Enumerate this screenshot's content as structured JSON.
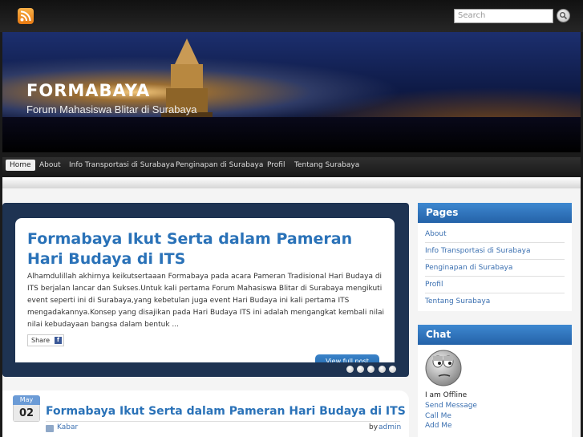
{
  "search": {
    "placeholder": "Search"
  },
  "site": {
    "title": "FORMABAYA",
    "description": "Forum Mahasiswa Blitar di Surabaya"
  },
  "nav": {
    "items": [
      "Home",
      "About",
      "Info Transportasi di Surabaya",
      "Penginapan di Surabaya",
      "Profil",
      "Tentang Surabaya"
    ]
  },
  "featured": {
    "title": "Formabaya Ikut Serta dalam Pameran Hari Budaya di ITS",
    "excerpt": "Alhamdulillah akhirnya keikutsertaaan Formabaya pada acara Pameran Tradisional Hari Budaya di ITS berjalan lancar dan Sukses.Untuk kali pertama Forum Mahasiswa Blitar di Surabaya mengikuti event seperti ini di Surabaya,yang kebetulan juga event Hari Budaya ini kali pertama ITS mengadakannya.Konsep yang disajikan pada Hari Budaya ITS ini adalah mengangkat kembali nilai nilai kebudayaan bangsa dalam bentuk ...",
    "share_label": "Share",
    "view_label": "View full post"
  },
  "post": {
    "month": "May",
    "day": "02",
    "title": "Formabaya Ikut Serta dalam Pameran Hari Budaya di ITS",
    "category": "Kabar",
    "by_label": "by",
    "author": "admin"
  },
  "pages_widget": {
    "title": "Pages",
    "items": [
      "About",
      "Info Transportasi di Surabaya",
      "Penginapan di Surabaya",
      "Profil",
      "Tentang Surabaya"
    ]
  },
  "chat_widget": {
    "title": "Chat",
    "status": "I am Offline",
    "links": [
      "Send Message",
      "Call Me",
      "Add Me"
    ]
  },
  "colors": {
    "accent": "#2a72b8",
    "widget_header": "#2f74bd",
    "slider_bg": "#1e3352"
  },
  "icons": [
    "rss-icon",
    "search-icon",
    "facebook-icon",
    "category-icon",
    "chat-avatar-icon"
  ]
}
